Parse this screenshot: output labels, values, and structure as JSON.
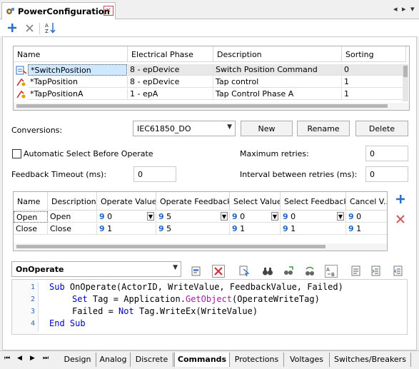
{
  "tab": {
    "title": "PowerConfiguration",
    "close": "×",
    "nav": [
      "◂",
      "▸",
      "▾"
    ]
  },
  "toolbar": {
    "add_label": "+",
    "delete_label": "✕",
    "sort_label": "AZ"
  },
  "upper_grid": {
    "headers": [
      "Name",
      "Electrical Phase",
      "Description",
      "Sorting"
    ],
    "rows": [
      {
        "name": "*SwitchPosition",
        "phase": "8 - epDevice",
        "desc": "Switch Position Command",
        "sort": "0"
      },
      {
        "name": "*TapPosition",
        "phase": "8 - epDevice",
        "desc": "Tap control",
        "sort": "1"
      },
      {
        "name": "*TapPositionA",
        "phase": "1 - epA",
        "desc": "Tap Control Phase A",
        "sort": "1"
      }
    ]
  },
  "conversions": {
    "label": "Conversions:",
    "value": "IEC61850_DO",
    "new": "New",
    "rename": "Rename",
    "delete": "Delete"
  },
  "options": {
    "auto_select": "Automatic Select Before Operate",
    "max_retries_label": "Maximum retries:",
    "max_retries": "0",
    "feedback_label": "Feedback Timeout (ms):",
    "feedback": "0",
    "interval_label": "Interval between retries (ms):",
    "interval": "0"
  },
  "lower_grid": {
    "headers": [
      "Name",
      "Description",
      "Operate Value",
      "Operate Feedback",
      "Select Value",
      "Select Feedback",
      "Cancel V..."
    ],
    "rows": [
      {
        "name": "Open",
        "desc": "Open",
        "op": "0",
        "opfb": "5",
        "sel": "0",
        "selfb": "0",
        "cancel": "0"
      },
      {
        "name": "Close",
        "desc": "Close",
        "op": "1",
        "opfb": "5",
        "sel": "1",
        "selfb": "1",
        "cancel": "1"
      }
    ],
    "nine": "9"
  },
  "script": {
    "event": "OnOperate",
    "lines": [
      "1",
      "2",
      "3",
      "4"
    ]
  },
  "code_text": {
    "l1_kw": "Sub",
    "l1_rest": " OnOperate(ActorID, WriteValue, FeedbackValue, Failed)",
    "l2_kw": "Set",
    "l2_a": " Tag = Application.",
    "l2_fn": "GetObject",
    "l2_b": "(OperateWriteTag)",
    "l3_a": "Failed = ",
    "l3_kw": "Not",
    "l3_b": " Tag.WriteEx(WriteValue)",
    "l4_kw": "End Sub"
  },
  "bottom_tabs": [
    "Design",
    "Analog",
    "Discrete",
    "Commands",
    "Protections",
    "Voltages",
    "Switches/Breakers"
  ],
  "bottom_nav": [
    "⏮",
    "◀",
    "▶",
    "⏭"
  ],
  "colors": {
    "accent": "#2366c4",
    "selection": "#cde8ff",
    "keyword": "#0000c0",
    "function": "#a020a0"
  }
}
